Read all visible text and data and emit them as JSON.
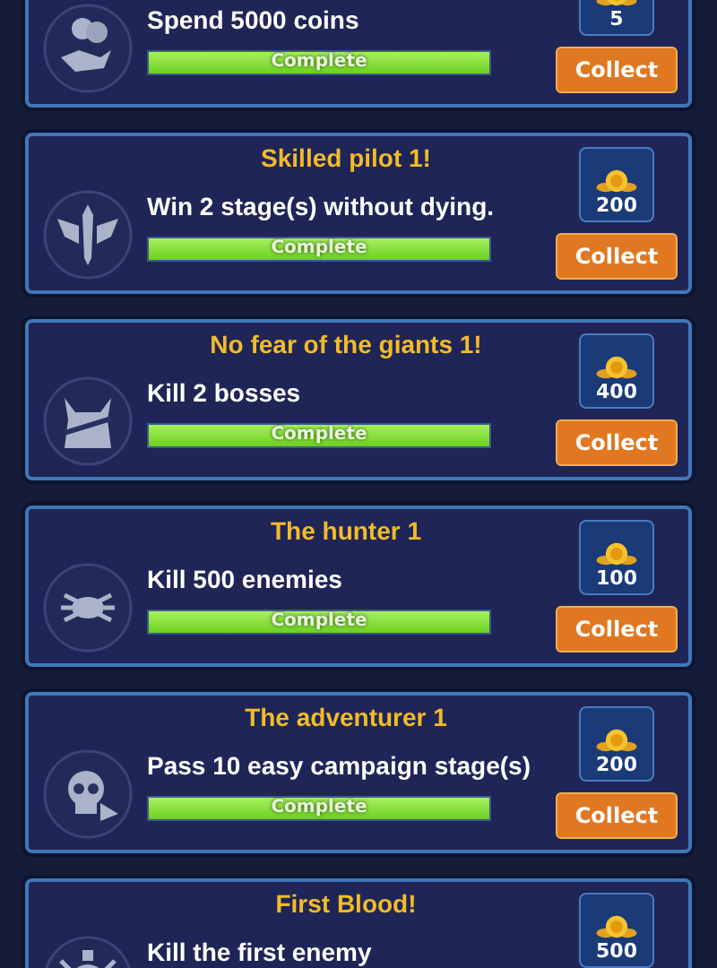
{
  "achievements": [
    {
      "description": "Spend 5000 coins",
      "reward": "5",
      "progress": {
        "level": 1,
        "label": "Complete"
      },
      "button": "Collect"
    },
    {
      "title": "Skilled pilot 1!",
      "description": "Win 2 stage(s) without dying.",
      "reward": "200",
      "progress": {
        "level": 1,
        "label": "Complete"
      },
      "button": "Collect"
    },
    {
      "title": "No fear of the giants 1!",
      "description": "Kill 2 bosses",
      "reward": "400",
      "progress": {
        "level": 1,
        "label": "Complete"
      },
      "button": "Collect"
    },
    {
      "title": "The hunter 1",
      "description": "Kill 500 enemies",
      "reward": "100",
      "progress": {
        "level": 1,
        "label": "Complete"
      },
      "button": "Collect"
    },
    {
      "title": "The adventurer 1",
      "description": "Pass 10 easy campaign stage(s)",
      "reward": "200",
      "progress": {
        "level": 1,
        "label": "Complete"
      },
      "button": "Collect"
    },
    {
      "title": "First Blood!",
      "description": "Kill the first enemy",
      "reward": "500"
    }
  ]
}
